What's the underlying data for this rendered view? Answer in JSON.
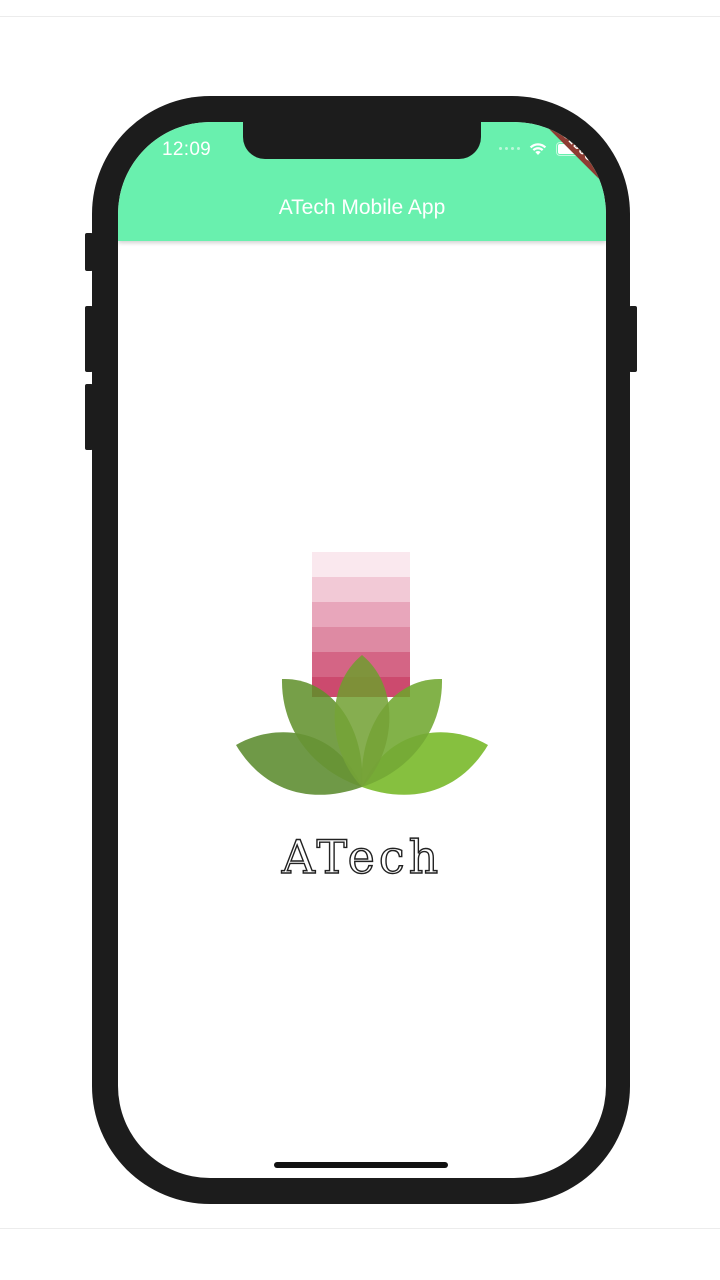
{
  "status_bar": {
    "time": "12:09",
    "icons": [
      "signal-dots-icon",
      "wifi-icon",
      "battery-icon"
    ]
  },
  "app_bar": {
    "title": "ATech Mobile App",
    "color": "#69f0ae",
    "debug_label": "DEBUG"
  },
  "splash": {
    "logo_name": "ATech",
    "stripe_colors": [
      "#fae8ee",
      "#f2c9d6",
      "#e8a6bb",
      "#de8aa3",
      "#d46585",
      "#cc4a6e"
    ],
    "leaf_colors": [
      "#5a8a2c",
      "#6e9e2e",
      "#78b82a"
    ]
  },
  "colors": {
    "phone_frame": "#1c1c1c",
    "screen": "#ffffff"
  }
}
